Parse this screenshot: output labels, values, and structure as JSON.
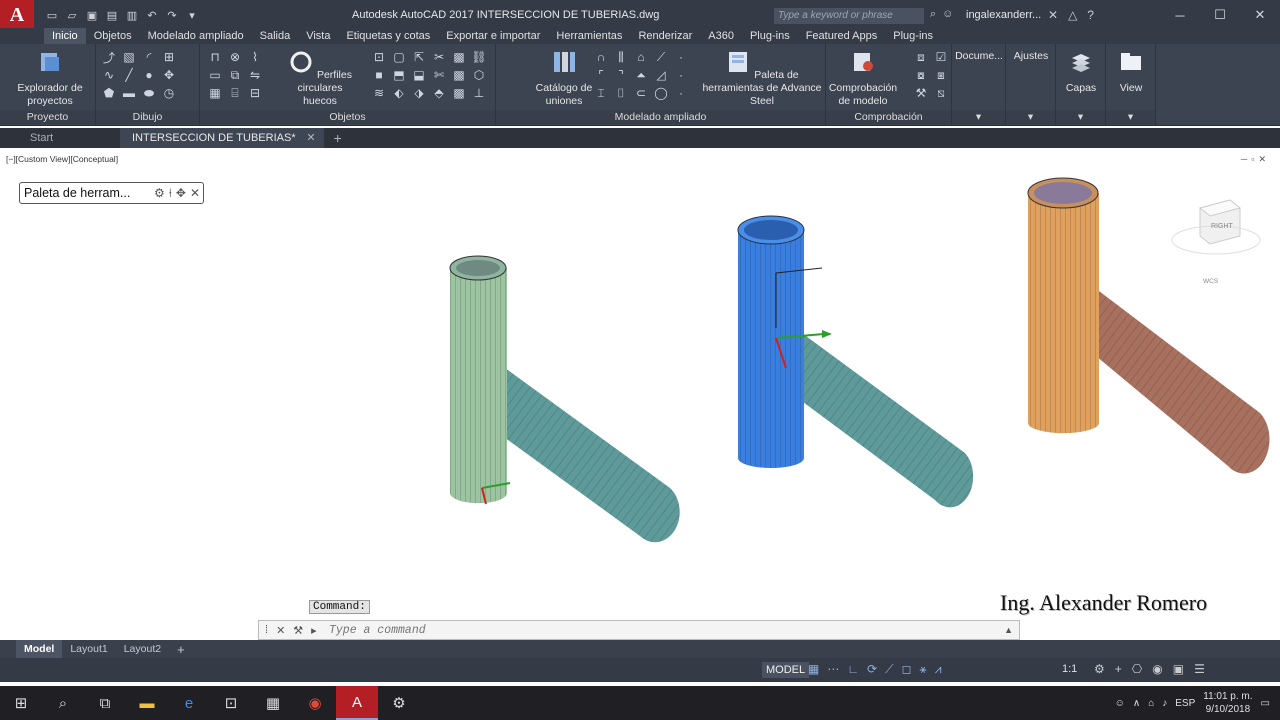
{
  "window": {
    "title": "Autodesk AutoCAD 2017     INTERSECCION DE TUBERIAS.dwg",
    "app_logo": "A",
    "search_placeholder": "Type a keyword or phrase",
    "user": "ingalexanderr..."
  },
  "ribbon_tabs": [
    {
      "label": "Inicio",
      "active": true
    },
    {
      "label": "Objetos"
    },
    {
      "label": "Modelado ampliado"
    },
    {
      "label": "Salida"
    },
    {
      "label": "Vista"
    },
    {
      "label": "Etiquetas y cotas"
    },
    {
      "label": "Exportar e importar"
    },
    {
      "label": "Herramientas"
    },
    {
      "label": "Renderizar"
    },
    {
      "label": "A360"
    },
    {
      "label": "Plug-ins"
    },
    {
      "label": "Featured Apps"
    },
    {
      "label": "Plug-ins"
    }
  ],
  "ribbon": {
    "project_explorer": "Explorador de proyectos",
    "circular_profiles": "Perfiles circulares huecos",
    "joint_catalog": "Catálogo de uniones",
    "tool_palette": "Paleta de herramientas de Advance Steel",
    "model_check": "Comprobación de modelo",
    "documents": "Docume...",
    "settings": "Ajustes",
    "layers": "Capas",
    "view": "View",
    "panels": {
      "proyecto": "Proyecto",
      "dibujo": "Dibujo",
      "objetos": "Objetos",
      "modelado": "Modelado ampliado",
      "comprobacion": "Comprobación"
    }
  },
  "doc_tabs": {
    "start": "Start",
    "active": "INTERSECCION DE TUBERIAS*"
  },
  "viewport": {
    "label": "[−][Custom View][Conceptual]",
    "palette_title": "Paleta de herram...",
    "viewcube_face": "RIGHT",
    "wcs": "WCS",
    "command_label": "Command:",
    "author": "Ing. Alexander Romero"
  },
  "command": {
    "placeholder": "Type a command"
  },
  "layouts": [
    {
      "label": "Model",
      "active": true
    },
    {
      "label": "Layout1"
    },
    {
      "label": "Layout2"
    }
  ],
  "status": {
    "model": "MODEL",
    "scale": "1:1"
  },
  "taskbar": {
    "lang": "ESP",
    "time": "11:01 p. m.",
    "date": "9/10/2018"
  },
  "colors": {
    "pipe1_vertical": "#9cc4a0",
    "pipe1_branch": "#5e9a9a",
    "pipe2_vertical": "#3a7fe0",
    "pipe2_branch": "#5e9a9a",
    "pipe3_vertical": "#e0a05e",
    "pipe3_branch": "#a8705e"
  }
}
